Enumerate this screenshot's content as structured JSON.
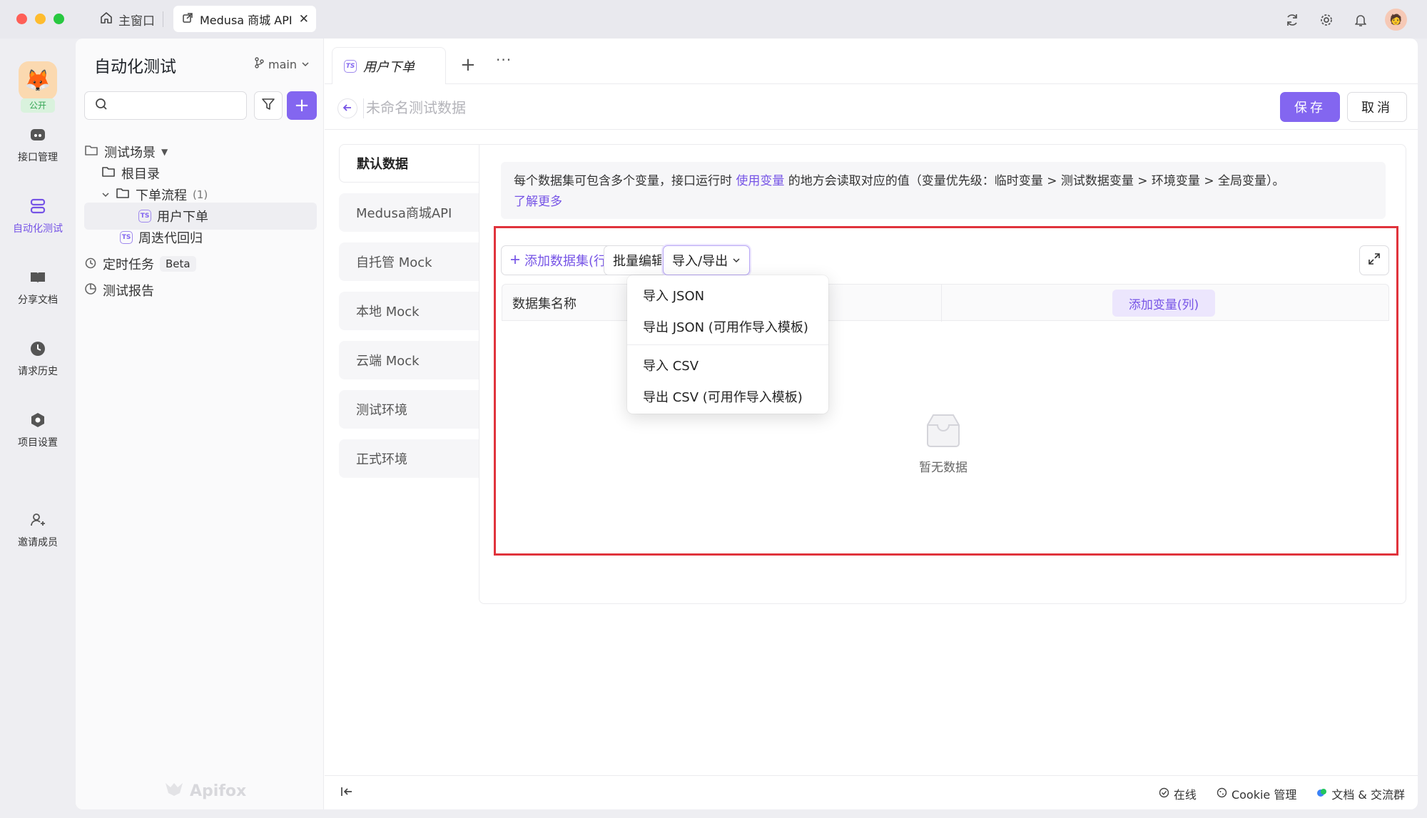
{
  "titlebar": {
    "home_tab": "主窗口",
    "active_tab": "Medusa 商城 API",
    "close_glyph": "✕"
  },
  "rail": {
    "public_badge": "公开",
    "items": [
      {
        "label": "接口管理",
        "icon": "api-icon"
      },
      {
        "label": "自动化测试",
        "icon": "automation-icon"
      },
      {
        "label": "分享文档",
        "icon": "book-icon"
      },
      {
        "label": "请求历史",
        "icon": "clock-icon"
      },
      {
        "label": "项目设置",
        "icon": "settings-icon"
      },
      {
        "label": "邀请成员",
        "icon": "add-user-icon"
      }
    ]
  },
  "sidebar": {
    "title": "自动化测试",
    "branch": "main",
    "add_glyph": "+",
    "tree": {
      "scenarios": "测试场景",
      "root": "根目录",
      "folder": "下单流程",
      "folder_count": "(1)",
      "case_selected": "用户下单",
      "case_other": "周迭代回归",
      "scheduled": "定时任务",
      "beta": "Beta",
      "reports": "测试报告"
    },
    "watermark": "Apifox"
  },
  "content": {
    "tab_label": "用户下单",
    "tab_add": "+",
    "tab_more": "···",
    "name_placeholder": "未命名测试数据",
    "save": "保存",
    "cancel": "取消",
    "environments": [
      "默认数据",
      "Medusa商城API",
      "自托管 Mock",
      "本地 Mock",
      "云端 Mock",
      "测试环境",
      "正式环境"
    ],
    "info_text_1": "每个数据集可包含多个变量，接口运行时 ",
    "info_link_1": "使用变量",
    "info_text_2": " 的地方会读取对应的值（变量优先级：临时变量 > 测试数据变量 > 环境变量 > 全局变量）。",
    "info_link_2": "了解更多",
    "add_dataset": "添加数据集(行)",
    "batch_edit": "批量编辑",
    "import_export": "导入/导出",
    "col_name": "数据集名称",
    "add_variable": "添加变量(列)",
    "empty": "暂无数据",
    "dropdown": {
      "import_json": "导入 JSON",
      "export_json": "导出 JSON (可用作导入模板)",
      "import_csv": "导入 CSV",
      "export_csv": "导出 CSV (可用作导入模板)"
    }
  },
  "statusbar": {
    "online": "在线",
    "cookie": "Cookie 管理",
    "docs": "文档 & 交流群"
  },
  "colors": {
    "accent": "#8366f0",
    "highlight_border": "#e0333c"
  }
}
